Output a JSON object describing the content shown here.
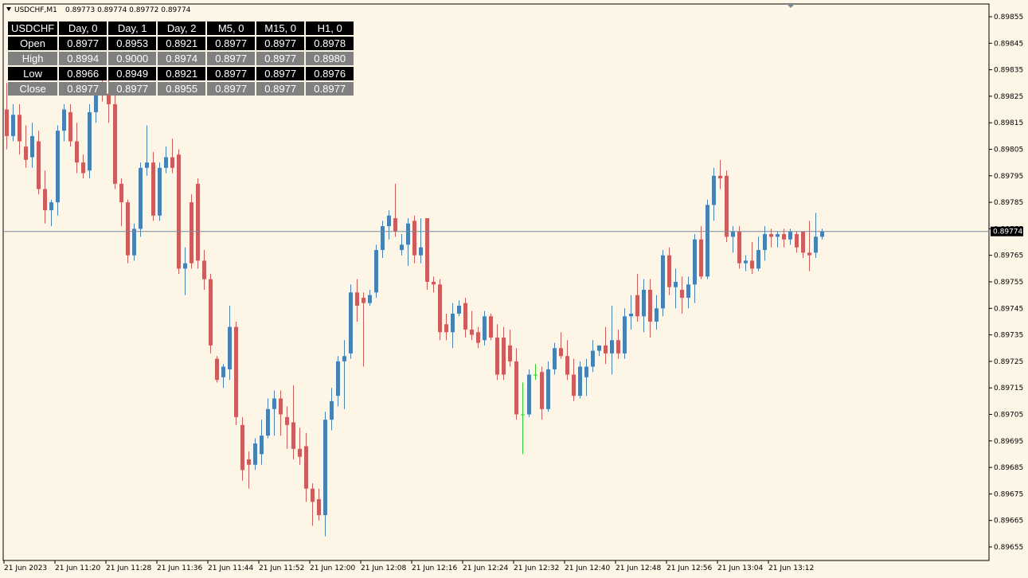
{
  "header": {
    "symbol_timeframe": "USDCHF,M1",
    "quote_values": "0.89773 0.89774 0.89772 0.89774"
  },
  "table": {
    "columns": [
      "USDCHF",
      "Day, 0",
      "Day, 1",
      "Day, 2",
      "M5, 0",
      "M15, 0",
      "H1, 0"
    ],
    "rows": [
      {
        "label": "Open",
        "values": [
          "0.8977",
          "0.8953",
          "0.8921",
          "0.8977",
          "0.8977",
          "0.8978"
        ]
      },
      {
        "label": "High",
        "values": [
          "0.8994",
          "0.9000",
          "0.8974",
          "0.8977",
          "0.8977",
          "0.8980"
        ]
      },
      {
        "label": "Low",
        "values": [
          "0.8966",
          "0.8949",
          "0.8921",
          "0.8977",
          "0.8977",
          "0.8976"
        ]
      },
      {
        "label": "Close",
        "values": [
          "0.8977",
          "0.8977",
          "0.8955",
          "0.8977",
          "0.8977",
          "0.8977"
        ]
      }
    ]
  },
  "colors": {
    "background": "#fdf5e6",
    "bull": "#4682b4",
    "bear": "#cd5c5c",
    "doji": "#32cd32",
    "grid_line": "#778899",
    "axis": "#000000"
  },
  "chart_data": {
    "type": "candlestick",
    "symbol": "USDCHF",
    "timeframe": "M1",
    "ylim": [
      0.8965,
      0.8986
    ],
    "y_ticks": [
      "0.89855",
      "0.89845",
      "0.89835",
      "0.89825",
      "0.89815",
      "0.89805",
      "0.89795",
      "0.89785",
      "0.89775",
      "0.89765",
      "0.89755",
      "0.89745",
      "0.89735",
      "0.89725",
      "0.89715",
      "0.89705",
      "0.89695",
      "0.89685",
      "0.89675",
      "0.89665",
      "0.89655"
    ],
    "x_ticks": [
      "21 Jun 2023",
      "21 Jun 11:20",
      "21 Jun 11:28",
      "21 Jun 11:36",
      "21 Jun 11:44",
      "21 Jun 11:52",
      "21 Jun 12:00",
      "21 Jun 12:08",
      "21 Jun 12:16",
      "21 Jun 12:24",
      "21 Jun 12:32",
      "21 Jun 12:40",
      "21 Jun 12:48",
      "21 Jun 12:56",
      "21 Jun 13:04",
      "21 Jun 13:12"
    ],
    "current_price": "0.89774",
    "candles": [
      {
        "o": 0.8982,
        "h": 0.8983,
        "l": 0.89805,
        "c": 0.8981
      },
      {
        "o": 0.8981,
        "h": 0.89822,
        "l": 0.89808,
        "c": 0.89818
      },
      {
        "o": 0.89818,
        "h": 0.89822,
        "l": 0.89803,
        "c": 0.89808
      },
      {
        "o": 0.89806,
        "h": 0.89814,
        "l": 0.89798,
        "c": 0.89801
      },
      {
        "o": 0.89802,
        "h": 0.89815,
        "l": 0.89798,
        "c": 0.8981
      },
      {
        "o": 0.89808,
        "h": 0.89812,
        "l": 0.89788,
        "c": 0.8979
      },
      {
        "o": 0.8979,
        "h": 0.89797,
        "l": 0.89777,
        "c": 0.89782
      },
      {
        "o": 0.89782,
        "h": 0.89786,
        "l": 0.89776,
        "c": 0.89785
      },
      {
        "o": 0.89785,
        "h": 0.89814,
        "l": 0.8978,
        "c": 0.89812
      },
      {
        "o": 0.89812,
        "h": 0.89822,
        "l": 0.89808,
        "c": 0.8982
      },
      {
        "o": 0.89819,
        "h": 0.89822,
        "l": 0.89806,
        "c": 0.89808
      },
      {
        "o": 0.89808,
        "h": 0.89815,
        "l": 0.89796,
        "c": 0.898
      },
      {
        "o": 0.898,
        "h": 0.89803,
        "l": 0.89794,
        "c": 0.89796
      },
      {
        "o": 0.89797,
        "h": 0.89822,
        "l": 0.89794,
        "c": 0.89819
      },
      {
        "o": 0.89819,
        "h": 0.8983,
        "l": 0.89815,
        "c": 0.89827
      },
      {
        "o": 0.89827,
        "h": 0.89832,
        "l": 0.89823,
        "c": 0.89826
      },
      {
        "o": 0.89826,
        "h": 0.89832,
        "l": 0.89815,
        "c": 0.89822
      },
      {
        "o": 0.89822,
        "h": 0.89826,
        "l": 0.8979,
        "c": 0.89792
      },
      {
        "o": 0.89792,
        "h": 0.89794,
        "l": 0.89776,
        "c": 0.89785
      },
      {
        "o": 0.89785,
        "h": 0.89786,
        "l": 0.89762,
        "c": 0.89765
      },
      {
        "o": 0.89765,
        "h": 0.89777,
        "l": 0.89763,
        "c": 0.89775
      },
      {
        "o": 0.89775,
        "h": 0.898,
        "l": 0.89772,
        "c": 0.89798
      },
      {
        "o": 0.89798,
        "h": 0.89814,
        "l": 0.89795,
        "c": 0.898
      },
      {
        "o": 0.898,
        "h": 0.89804,
        "l": 0.89778,
        "c": 0.8978
      },
      {
        "o": 0.8978,
        "h": 0.898,
        "l": 0.89778,
        "c": 0.89798
      },
      {
        "o": 0.89798,
        "h": 0.89806,
        "l": 0.89796,
        "c": 0.89802
      },
      {
        "o": 0.89802,
        "h": 0.89809,
        "l": 0.89796,
        "c": 0.89798
      },
      {
        "o": 0.89803,
        "h": 0.89805,
        "l": 0.89758,
        "c": 0.8976
      },
      {
        "o": 0.8976,
        "h": 0.89768,
        "l": 0.8975,
        "c": 0.89762
      },
      {
        "o": 0.89785,
        "h": 0.89788,
        "l": 0.8976,
        "c": 0.89762
      },
      {
        "o": 0.89792,
        "h": 0.89794,
        "l": 0.8976,
        "c": 0.89763
      },
      {
        "o": 0.89763,
        "h": 0.89767,
        "l": 0.89752,
        "c": 0.89756
      },
      {
        "o": 0.89756,
        "h": 0.89758,
        "l": 0.89728,
        "c": 0.89731
      },
      {
        "o": 0.89726,
        "h": 0.89727,
        "l": 0.89717,
        "c": 0.89718
      },
      {
        "o": 0.89719,
        "h": 0.89724,
        "l": 0.89715,
        "c": 0.89723
      },
      {
        "o": 0.89722,
        "h": 0.89746,
        "l": 0.89718,
        "c": 0.89738
      },
      {
        "o": 0.89738,
        "h": 0.8974,
        "l": 0.89701,
        "c": 0.89704
      },
      {
        "o": 0.89701,
        "h": 0.89704,
        "l": 0.8968,
        "c": 0.89684
      },
      {
        "o": 0.89688,
        "h": 0.89691,
        "l": 0.89677,
        "c": 0.89686
      },
      {
        "o": 0.89686,
        "h": 0.89696,
        "l": 0.89684,
        "c": 0.89694
      },
      {
        "o": 0.8969,
        "h": 0.89703,
        "l": 0.89686,
        "c": 0.89697
      },
      {
        "o": 0.89697,
        "h": 0.89711,
        "l": 0.89696,
        "c": 0.89707
      },
      {
        "o": 0.89707,
        "h": 0.89714,
        "l": 0.89697,
        "c": 0.89711
      },
      {
        "o": 0.89711,
        "h": 0.89714,
        "l": 0.89697,
        "c": 0.89705
      },
      {
        "o": 0.89704,
        "h": 0.89708,
        "l": 0.89692,
        "c": 0.89701
      },
      {
        "o": 0.89702,
        "h": 0.89716,
        "l": 0.89688,
        "c": 0.89692
      },
      {
        "o": 0.89692,
        "h": 0.897,
        "l": 0.89686,
        "c": 0.89689
      },
      {
        "o": 0.89693,
        "h": 0.89698,
        "l": 0.89672,
        "c": 0.89677
      },
      {
        "o": 0.89677,
        "h": 0.89679,
        "l": 0.89663,
        "c": 0.89672
      },
      {
        "o": 0.89673,
        "h": 0.89677,
        "l": 0.89665,
        "c": 0.89667
      },
      {
        "o": 0.89667,
        "h": 0.89706,
        "l": 0.89659,
        "c": 0.89703
      },
      {
        "o": 0.89703,
        "h": 0.89715,
        "l": 0.89699,
        "c": 0.8971
      },
      {
        "o": 0.89712,
        "h": 0.89727,
        "l": 0.89708,
        "c": 0.89725
      },
      {
        "o": 0.89725,
        "h": 0.89733,
        "l": 0.89707,
        "c": 0.89727
      },
      {
        "o": 0.89728,
        "h": 0.89754,
        "l": 0.89726,
        "c": 0.89751
      },
      {
        "o": 0.89751,
        "h": 0.89756,
        "l": 0.8974,
        "c": 0.89746
      },
      {
        "o": 0.89749,
        "h": 0.89751,
        "l": 0.89723,
        "c": 0.89747
      },
      {
        "o": 0.89747,
        "h": 0.89752,
        "l": 0.89746,
        "c": 0.8975
      },
      {
        "o": 0.89751,
        "h": 0.89769,
        "l": 0.89749,
        "c": 0.89767
      },
      {
        "o": 0.89767,
        "h": 0.89778,
        "l": 0.89764,
        "c": 0.89776
      },
      {
        "o": 0.89776,
        "h": 0.89782,
        "l": 0.89771,
        "c": 0.8978
      },
      {
        "o": 0.89779,
        "h": 0.89792,
        "l": 0.89772,
        "c": 0.89774
      },
      {
        "o": 0.89767,
        "h": 0.89773,
        "l": 0.89765,
        "c": 0.89769
      },
      {
        "o": 0.89769,
        "h": 0.89779,
        "l": 0.89761,
        "c": 0.89777
      },
      {
        "o": 0.89778,
        "h": 0.8978,
        "l": 0.89762,
        "c": 0.89765
      },
      {
        "o": 0.89765,
        "h": 0.89779,
        "l": 0.89762,
        "c": 0.89768
      },
      {
        "o": 0.89779,
        "h": 0.89779,
        "l": 0.89752,
        "c": 0.89755
      },
      {
        "o": 0.89755,
        "h": 0.89757,
        "l": 0.89751,
        "c": 0.89754
      },
      {
        "o": 0.89754,
        "h": 0.89756,
        "l": 0.89733,
        "c": 0.89736
      },
      {
        "o": 0.89739,
        "h": 0.89743,
        "l": 0.89733,
        "c": 0.89736
      },
      {
        "o": 0.89736,
        "h": 0.89747,
        "l": 0.8973,
        "c": 0.89743
      },
      {
        "o": 0.89743,
        "h": 0.89748,
        "l": 0.89742,
        "c": 0.89746
      },
      {
        "o": 0.89747,
        "h": 0.89749,
        "l": 0.89734,
        "c": 0.89737
      },
      {
        "o": 0.89737,
        "h": 0.89744,
        "l": 0.89733,
        "c": 0.89735
      },
      {
        "o": 0.89736,
        "h": 0.89738,
        "l": 0.8973,
        "c": 0.89732
      },
      {
        "o": 0.89733,
        "h": 0.89744,
        "l": 0.89731,
        "c": 0.89742
      },
      {
        "o": 0.89742,
        "h": 0.89743,
        "l": 0.89733,
        "c": 0.89734
      },
      {
        "o": 0.89734,
        "h": 0.89739,
        "l": 0.89718,
        "c": 0.8972
      },
      {
        "o": 0.89734,
        "h": 0.89738,
        "l": 0.89718,
        "c": 0.8972
      },
      {
        "o": 0.89731,
        "h": 0.89737,
        "l": 0.89723,
        "c": 0.89725
      },
      {
        "o": 0.89725,
        "h": 0.8973,
        "l": 0.89703,
        "c": 0.89705
      },
      {
        "o": 0.89705,
        "h": 0.89717,
        "l": 0.8969,
        "c": 0.89705
      },
      {
        "o": 0.89705,
        "h": 0.89722,
        "l": 0.89704,
        "c": 0.8972
      },
      {
        "o": 0.8972,
        "h": 0.89724,
        "l": 0.89718,
        "c": 0.8972
      },
      {
        "o": 0.89721,
        "h": 0.89723,
        "l": 0.89703,
        "c": 0.89707
      },
      {
        "o": 0.89707,
        "h": 0.89725,
        "l": 0.89706,
        "c": 0.89722
      },
      {
        "o": 0.89722,
        "h": 0.89732,
        "l": 0.8972,
        "c": 0.8973
      },
      {
        "o": 0.8973,
        "h": 0.89736,
        "l": 0.89726,
        "c": 0.89727
      },
      {
        "o": 0.89727,
        "h": 0.89733,
        "l": 0.89718,
        "c": 0.8972
      },
      {
        "o": 0.8972,
        "h": 0.89726,
        "l": 0.8971,
        "c": 0.89712
      },
      {
        "o": 0.89712,
        "h": 0.89725,
        "l": 0.89711,
        "c": 0.89723
      },
      {
        "o": 0.89719,
        "h": 0.89726,
        "l": 0.89712,
        "c": 0.89723
      },
      {
        "o": 0.89723,
        "h": 0.89733,
        "l": 0.89721,
        "c": 0.89729
      },
      {
        "o": 0.89729,
        "h": 0.89731,
        "l": 0.89727,
        "c": 0.89731
      },
      {
        "o": 0.89731,
        "h": 0.89738,
        "l": 0.89724,
        "c": 0.89728
      },
      {
        "o": 0.89728,
        "h": 0.89746,
        "l": 0.8972,
        "c": 0.89733
      },
      {
        "o": 0.89733,
        "h": 0.89737,
        "l": 0.89726,
        "c": 0.89728
      },
      {
        "o": 0.89728,
        "h": 0.89745,
        "l": 0.89726,
        "c": 0.89742
      },
      {
        "o": 0.89742,
        "h": 0.8975,
        "l": 0.89737,
        "c": 0.89743
      },
      {
        "o": 0.8975,
        "h": 0.89758,
        "l": 0.8974,
        "c": 0.89742
      },
      {
        "o": 0.89742,
        "h": 0.89756,
        "l": 0.89736,
        "c": 0.89752
      },
      {
        "o": 0.89752,
        "h": 0.89756,
        "l": 0.89734,
        "c": 0.8974
      },
      {
        "o": 0.8974,
        "h": 0.8975,
        "l": 0.89737,
        "c": 0.89745
      },
      {
        "o": 0.89745,
        "h": 0.89767,
        "l": 0.89742,
        "c": 0.89765
      },
      {
        "o": 0.89765,
        "h": 0.89768,
        "l": 0.8975,
        "c": 0.89753
      },
      {
        "o": 0.89753,
        "h": 0.8976,
        "l": 0.89745,
        "c": 0.89755
      },
      {
        "o": 0.89752,
        "h": 0.89757,
        "l": 0.89743,
        "c": 0.89749
      },
      {
        "o": 0.89749,
        "h": 0.89757,
        "l": 0.89745,
        "c": 0.89754
      },
      {
        "o": 0.89754,
        "h": 0.89773,
        "l": 0.89747,
        "c": 0.89771
      },
      {
        "o": 0.89771,
        "h": 0.89776,
        "l": 0.89756,
        "c": 0.89757
      },
      {
        "o": 0.89757,
        "h": 0.89786,
        "l": 0.89756,
        "c": 0.89784
      },
      {
        "o": 0.89784,
        "h": 0.89798,
        "l": 0.89778,
        "c": 0.89795
      },
      {
        "o": 0.89795,
        "h": 0.89801,
        "l": 0.8979,
        "c": 0.89794
      },
      {
        "o": 0.89795,
        "h": 0.89797,
        "l": 0.8977,
        "c": 0.89772
      },
      {
        "o": 0.89772,
        "h": 0.89776,
        "l": 0.89766,
        "c": 0.89774
      },
      {
        "o": 0.89774,
        "h": 0.89776,
        "l": 0.8976,
        "c": 0.89762
      },
      {
        "o": 0.89762,
        "h": 0.89765,
        "l": 0.89759,
        "c": 0.89763
      },
      {
        "o": 0.89763,
        "h": 0.8977,
        "l": 0.89758,
        "c": 0.8976
      },
      {
        "o": 0.8976,
        "h": 0.89772,
        "l": 0.89759,
        "c": 0.89767
      },
      {
        "o": 0.89767,
        "h": 0.89776,
        "l": 0.89763,
        "c": 0.89773
      },
      {
        "o": 0.89773,
        "h": 0.89775,
        "l": 0.89768,
        "c": 0.89772
      },
      {
        "o": 0.89772,
        "h": 0.89774,
        "l": 0.89768,
        "c": 0.89773
      },
      {
        "o": 0.89773,
        "h": 0.89775,
        "l": 0.89768,
        "c": 0.89771
      },
      {
        "o": 0.89771,
        "h": 0.89775,
        "l": 0.89769,
        "c": 0.89774
      },
      {
        "o": 0.89773,
        "h": 0.89774,
        "l": 0.89766,
        "c": 0.89768
      },
      {
        "o": 0.89774,
        "h": 0.89774,
        "l": 0.89764,
        "c": 0.89766
      },
      {
        "o": 0.89766,
        "h": 0.89778,
        "l": 0.89759,
        "c": 0.89765
      },
      {
        "o": 0.89766,
        "h": 0.89781,
        "l": 0.89764,
        "c": 0.89772
      },
      {
        "o": 0.89772,
        "h": 0.89775,
        "l": 0.89771,
        "c": 0.89774
      }
    ]
  }
}
